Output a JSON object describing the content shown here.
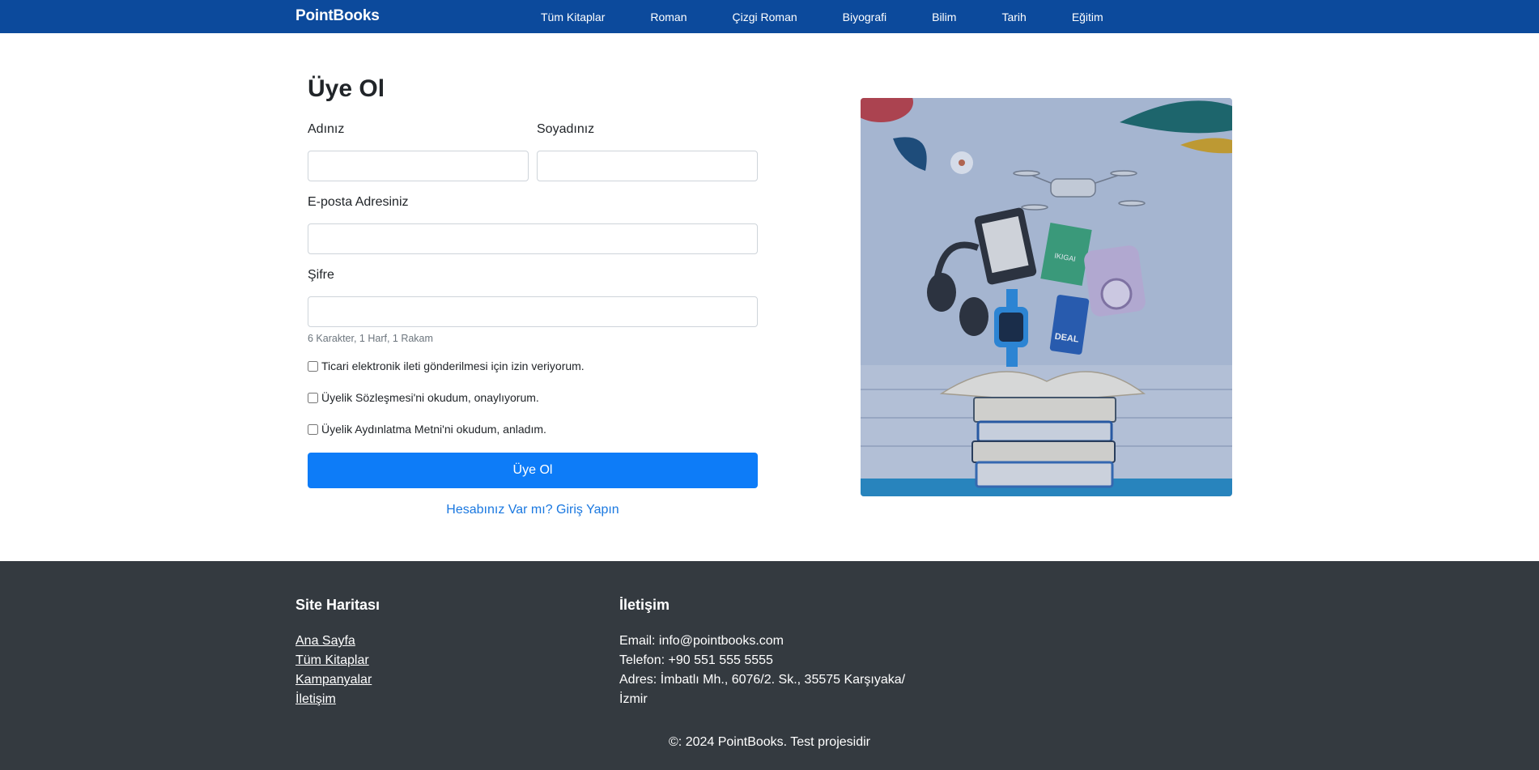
{
  "navbar": {
    "brand": "PointBooks",
    "links": [
      "Tüm Kitaplar",
      "Roman",
      "Çizgi Roman",
      "Biyografi",
      "Bilim",
      "Tarih",
      "Eğitim"
    ]
  },
  "form": {
    "title": "Üye Ol",
    "first_name_label": "Adınız",
    "first_name_value": "",
    "last_name_label": "Soyadınız",
    "last_name_value": "",
    "email_label": "E-posta Adresiniz",
    "email_value": "",
    "password_label": "Şifre",
    "password_value": "",
    "password_hint": "6 Karakter, 1 Harf, 1 Rakam",
    "checkboxes": [
      {
        "label": "Ticari elektronik ileti gönderilmesi için izin veriyorum.",
        "checked": false
      },
      {
        "label": "Üyelik Sözleşmesi'ni okudum, onaylıyorum.",
        "checked": false
      },
      {
        "label": "Üyelik Aydınlatma Metni'ni okudum, anladım.",
        "checked": false
      }
    ],
    "submit_label": "Üye Ol",
    "login_link": "Hesabınız Var mı? Giriş Yapın"
  },
  "hero": {
    "colors": {
      "background": "#b9c6dc",
      "floor": "#2b8fc6"
    },
    "book_title": "IKIGAI",
    "card_text": "DEAL"
  },
  "footer": {
    "sitemap_title": "Site Haritası",
    "sitemap_links": [
      "Ana Sayfa",
      "Tüm Kitaplar",
      "Kampanyalar",
      "İletişim"
    ],
    "contact_title": "İletişim",
    "email": "Email: info@pointbooks.com",
    "phone": "Telefon: +90 551 555 5555",
    "address": "Adres: İmbatlı Mh., 6076/2. Sk., 35575 Karşıyaka/ İzmir",
    "copyright": "©: 2024 PointBooks. Test projesidir"
  },
  "colors": {
    "navbar": "#0c4a9c",
    "primary_button": "#0d7cf8",
    "link": "#1a78e0",
    "footer": "#343a40"
  }
}
